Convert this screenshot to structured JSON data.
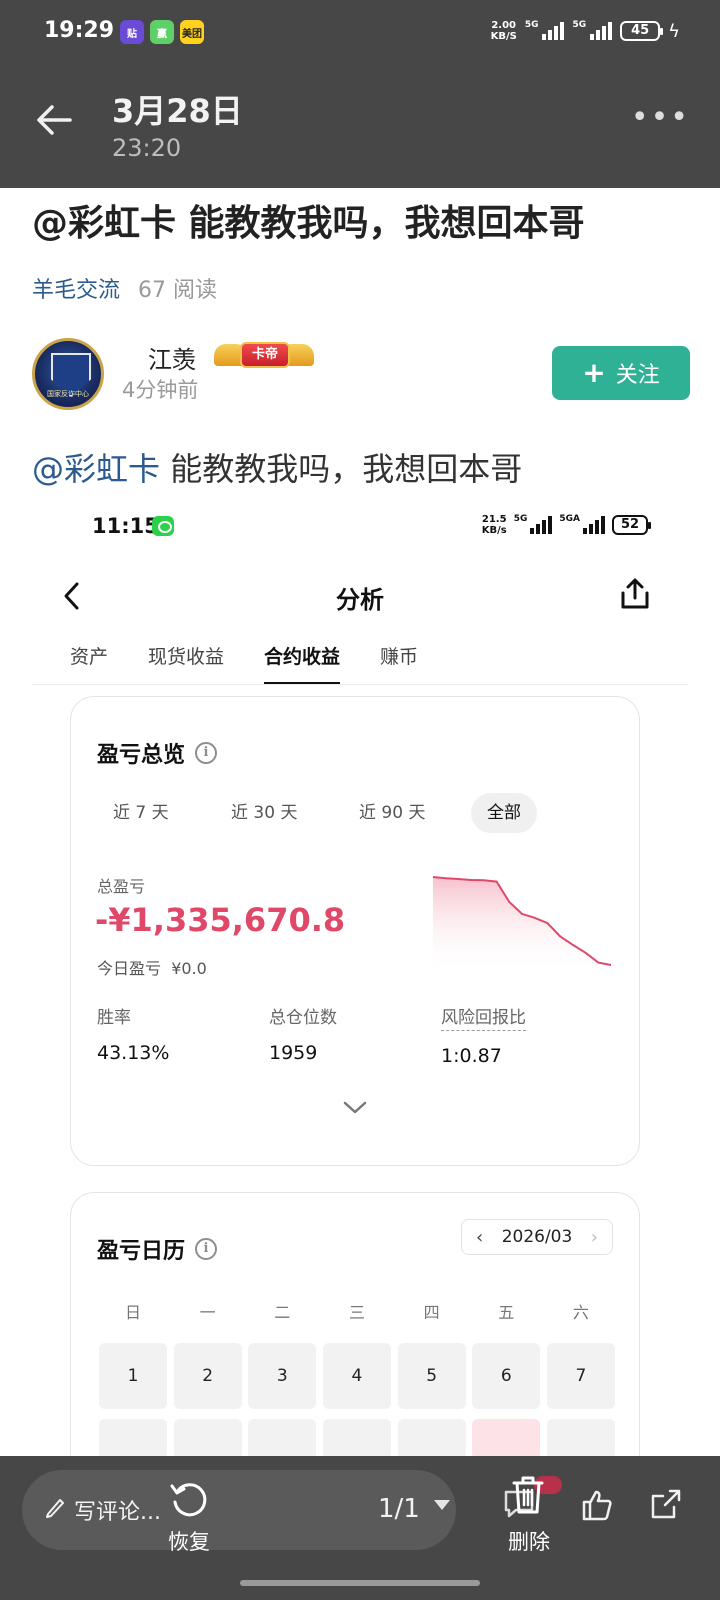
{
  "status_bar": {
    "time": "19:29",
    "apps": [
      {
        "label": "贴",
        "bg": "#6a4bd6",
        "fg": "#ffffff"
      },
      {
        "label": "赢",
        "bg": "#5fd068",
        "fg": "#ffffff"
      },
      {
        "label": "美团",
        "bg": "#ffd21f",
        "fg": "#222222"
      }
    ],
    "net_speed": "2.00",
    "net_unit": "KB/S",
    "sim1": "5G",
    "sim2": "5G",
    "battery": "45"
  },
  "header": {
    "date": "3月28日",
    "time": "23:20",
    "more_icon": "more-horizontal-icon"
  },
  "post": {
    "title": "@彩虹卡 能教教我吗，我想回本哥",
    "topic": "羊毛交流",
    "reads": "67 阅读",
    "author": {
      "name": "江羡",
      "badge": "卡帝",
      "posted": "4分钟前",
      "avatar_text": "国家反诈中心"
    },
    "follow_plus": "+",
    "follow_label": "关注",
    "body_mention": "@彩虹卡",
    "body_rest": " 能教教我吗，我想回本哥"
  },
  "embedded": {
    "status": {
      "time": "11:15",
      "net_speed": "21.5",
      "net_unit": "KB/s",
      "sim1": "5G",
      "sim2": "5GA",
      "battery": "52"
    },
    "title": "分析",
    "tabs": [
      {
        "label": "资产",
        "active": false
      },
      {
        "label": "现货收益",
        "active": false
      },
      {
        "label": "合约收益",
        "active": true
      },
      {
        "label": "赚币",
        "active": false
      }
    ],
    "overview": {
      "heading": "盈亏总览",
      "ranges": [
        "近 7 天",
        "近 30 天",
        "近 90 天",
        "全部"
      ],
      "selected_range": "全部",
      "total_label": "总盈亏",
      "total_value": "-¥1,335,670.8",
      "today_label": "今日盈亏",
      "today_value": "¥0.0",
      "stats": [
        {
          "label": "胜率",
          "value": "43.13%"
        },
        {
          "label": "总仓位数",
          "value": "1959"
        },
        {
          "label": "风险回报比",
          "value": "1:0.87"
        }
      ],
      "loss_color": "#e0486a"
    },
    "calendar": {
      "heading": "盈亏日历",
      "month": "2026/03",
      "weekdays": [
        "日",
        "一",
        "二",
        "三",
        "四",
        "五",
        "六"
      ],
      "first_week": [
        "1",
        "2",
        "3",
        "4",
        "5",
        "6",
        "7"
      ]
    }
  },
  "bottom_bar": {
    "comment_placeholder": "写评论...",
    "restore_label": "恢复",
    "pager": "1/1",
    "delete_label": "删除"
  },
  "chart_data": {
    "type": "area",
    "title": "",
    "xlabel": "",
    "ylabel": "",
    "series": [
      {
        "values": [
          0,
          -20000,
          -30000,
          -45000,
          -50000,
          -70000,
          -380000,
          -560000,
          -620000,
          -700000,
          -900000,
          -1030000,
          -1150000,
          -1300000,
          -1335670.8
        ]
      }
    ],
    "color": "#e0486a"
  }
}
